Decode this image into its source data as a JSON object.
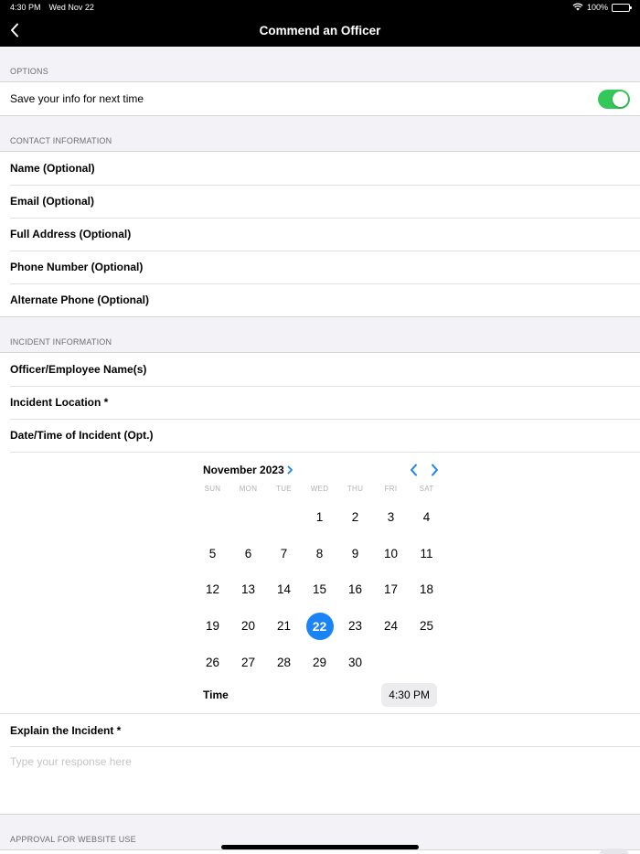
{
  "status_bar": {
    "time": "4:30 PM",
    "date": "Wed Nov 22",
    "battery": "100%"
  },
  "nav": {
    "title": "Commend an Officer"
  },
  "options": {
    "header": "OPTIONS",
    "save_info_label": "Save your info for next time",
    "save_info_on": true
  },
  "contact": {
    "header": "CONTACT INFORMATION",
    "fields": [
      "Name (Optional)",
      "Email (Optional)",
      "Full Address (Optional)",
      "Phone Number (Optional)",
      "Alternate Phone (Optional)"
    ]
  },
  "incident": {
    "header": "INCIDENT INFORMATION",
    "officer_label": "Officer/Employee Name(s)",
    "location_label": "Incident Location *",
    "datetime_label": "Date/Time of Incident (Opt.)",
    "explain_label": "Explain the Incident *",
    "explain_placeholder": "Type your response here"
  },
  "calendar": {
    "month_label": "November 2023",
    "weekdays": [
      "SUN",
      "MON",
      "TUE",
      "WED",
      "THU",
      "FRI",
      "SAT"
    ],
    "first_weekday_index": 3,
    "days_in_month": 30,
    "selected_day": 22,
    "time_label": "Time",
    "time_value": "4:30 PM",
    "accent_color": "#1a84f7"
  },
  "approval": {
    "header": "APPROVAL FOR WEBSITE USE"
  },
  "colors": {
    "toggle_on": "#34c759",
    "accent": "#1a84f7",
    "nav_bg": "#000000"
  }
}
